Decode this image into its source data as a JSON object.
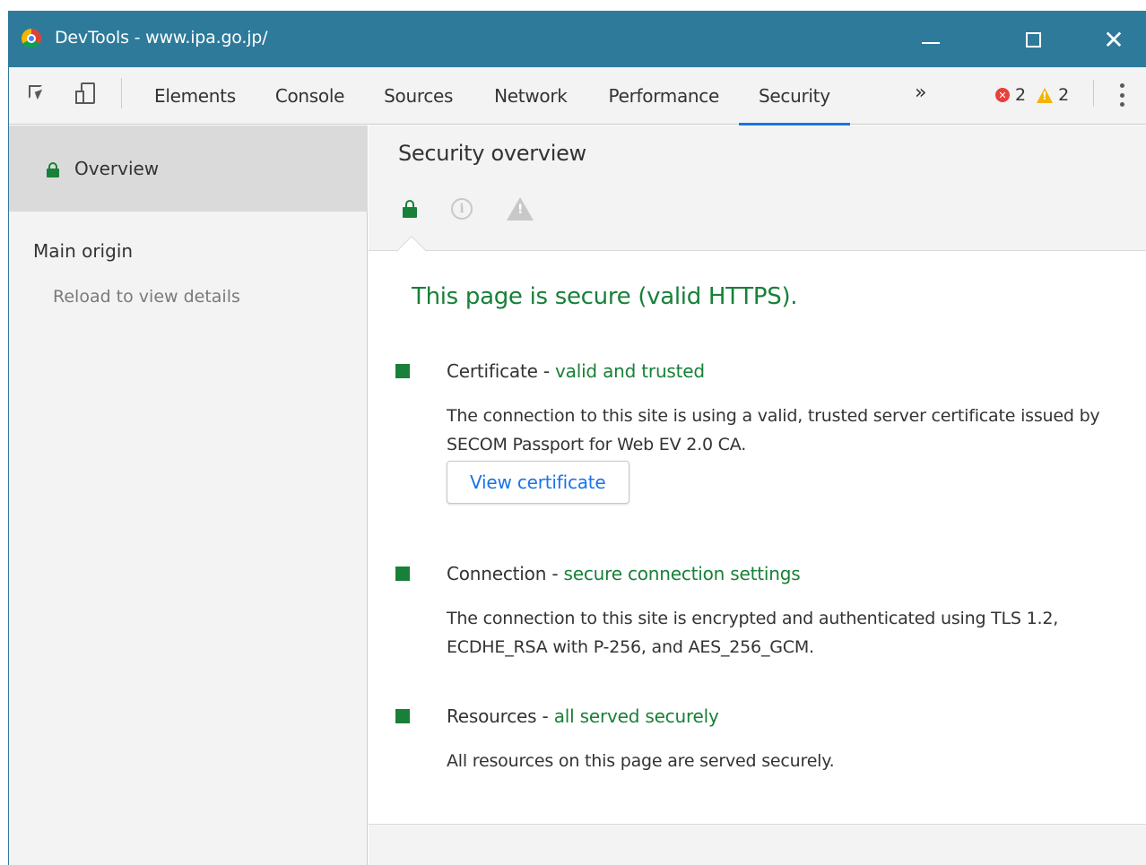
{
  "window": {
    "title": "DevTools - www.ipa.go.jp/",
    "minimize_icon": "minimize-icon",
    "maximize_icon": "maximize-icon",
    "close_label": "✕"
  },
  "toolbar": {
    "tabs": [
      {
        "label": "Elements"
      },
      {
        "label": "Console"
      },
      {
        "label": "Sources"
      },
      {
        "label": "Network"
      },
      {
        "label": "Performance"
      },
      {
        "label": "Security"
      }
    ],
    "active_tab": "Security",
    "more_label": "»",
    "error_count": "2",
    "warning_count": "2"
  },
  "sidebar": {
    "overview_label": "Overview",
    "main_origin_heading": "Main origin",
    "main_origin_hint": "Reload to view details"
  },
  "main": {
    "title": "Security overview",
    "summary": "This page is secure (valid HTTPS).",
    "sections": [
      {
        "title": "Certificate",
        "separator": " - ",
        "status": "valid and trusted",
        "description": "The connection to this site is using a valid, trusted server certificate issued by SECOM Passport for Web EV 2.0 CA.",
        "button_label": "View certificate"
      },
      {
        "title": "Connection",
        "separator": " - ",
        "status": "secure connection settings",
        "description": "The connection to this site is encrypted and authenticated using TLS 1.2, ECDHE_RSA with P-256, and AES_256_GCM."
      },
      {
        "title": "Resources",
        "separator": " - ",
        "status": "all served securely",
        "description": "All resources on this page are served securely."
      }
    ]
  },
  "colors": {
    "titlebar": "#2e7a9a",
    "secure_green": "#188038",
    "link_blue": "#1a73e8",
    "error_red": "#e8403a",
    "warning_yellow": "#f4b400"
  }
}
